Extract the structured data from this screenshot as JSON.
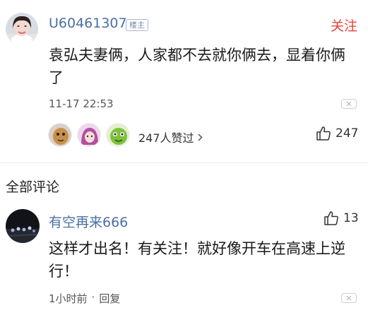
{
  "main_comment": {
    "username": "U60461307",
    "op_tag": "楼主",
    "follow_label": "关注",
    "text_line1": "袁弘夫妻俩，人家都不去就你俩去，显着你俩",
    "text_line2": "了",
    "timestamp": "11-17 22:53",
    "likers_text": "247人赞过",
    "like_count": "247"
  },
  "section": {
    "title": "全部评论"
  },
  "reply": {
    "username": "有空再来666",
    "like_count": "13",
    "text_line1": "这样才出名！有关注！就好像开车在高速上逆",
    "text_line2": "行！",
    "time": "1小时前",
    "separator": "·",
    "reply_label": "回复"
  },
  "colors": {
    "username": "#4a6fa5",
    "follow": "#e8433a"
  }
}
